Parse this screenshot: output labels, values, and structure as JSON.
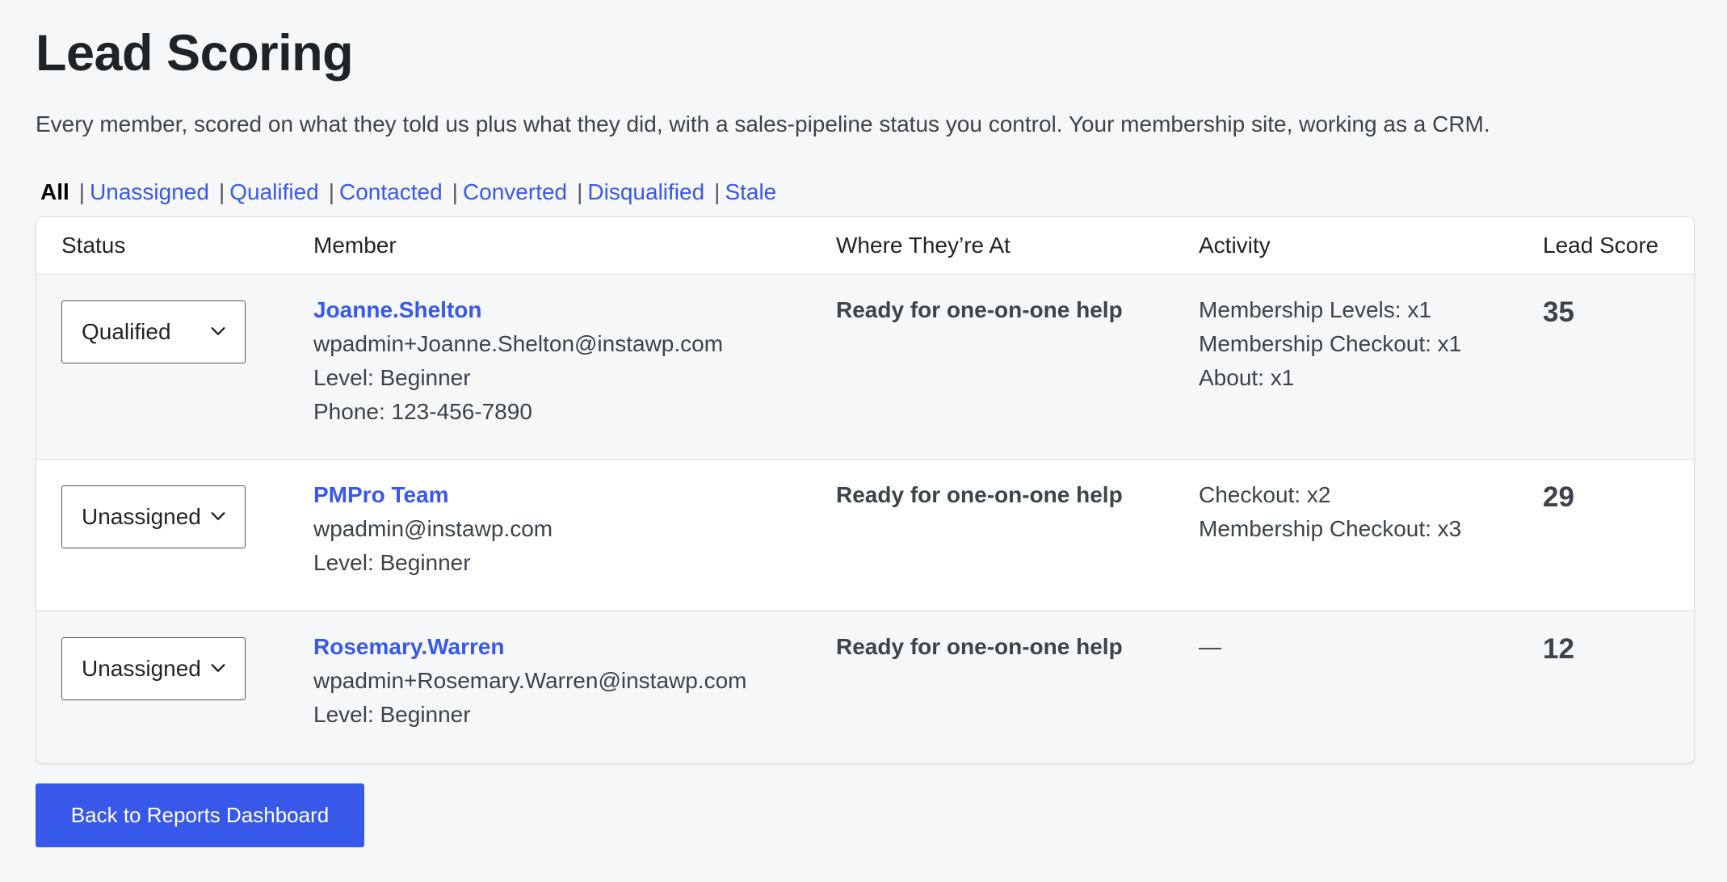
{
  "page": {
    "title": "Lead Scoring",
    "subtitle": "Every member, scored on what they told us plus what they did, with a sales-pipeline status you control. Your membership site, working as a CRM."
  },
  "filters": {
    "current": "All",
    "separator": "|",
    "links": [
      "Unassigned",
      "Qualified",
      "Contacted",
      "Converted",
      "Disqualified",
      "Stale"
    ]
  },
  "table": {
    "headers": {
      "status": "Status",
      "member": "Member",
      "where": "Where They’re At",
      "activity": "Activity",
      "score": "Lead Score"
    },
    "rows": [
      {
        "status": "Qualified",
        "name": "Joanne.Shelton",
        "email": "wpadmin+Joanne.Shelton@instawp.com",
        "level": "Level: Beginner",
        "phone": "Phone: 123-456-7890",
        "where": "Ready for one-on-one help",
        "activity": [
          "Membership Levels: x1",
          "Membership Checkout: x1",
          "About: x1"
        ],
        "score": "35"
      },
      {
        "status": "Unassigned",
        "name": "PMPro Team",
        "email": "wpadmin@instawp.com",
        "level": "Level: Beginner",
        "where": "Ready for one-on-one help",
        "activity": [
          "Checkout: x2",
          "Membership Checkout: x3"
        ],
        "score": "29"
      },
      {
        "status": "Unassigned",
        "name": "Rosemary.Warren",
        "email": "wpadmin+Rosemary.Warren@instawp.com",
        "level": "Level: Beginner",
        "where": "Ready for one-on-one help",
        "activity": [
          "—"
        ],
        "score": "12"
      }
    ]
  },
  "actions": {
    "back_label": "Back to Reports Dashboard"
  },
  "colors": {
    "accent": "#3858e9",
    "background": "#f6f7f9"
  },
  "icons": {
    "select_arrow": "chevron-down-icon"
  }
}
